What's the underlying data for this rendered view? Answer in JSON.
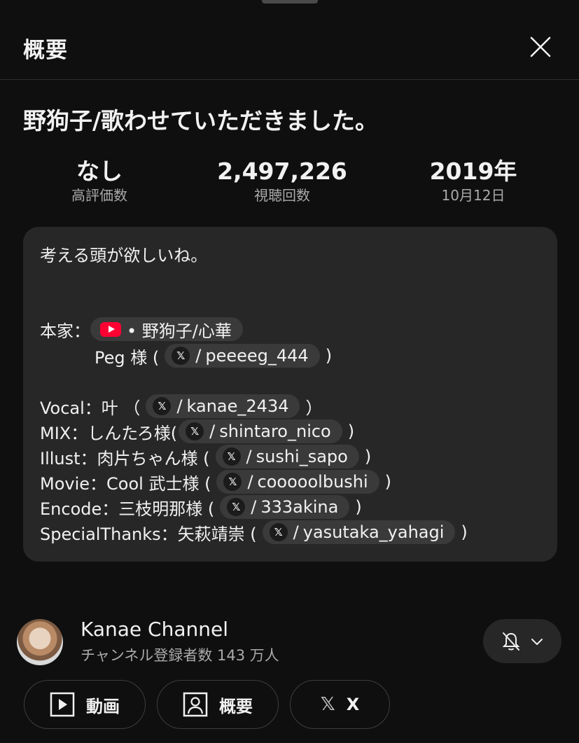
{
  "header": {
    "title": "概要"
  },
  "video": {
    "title": "野狗子/歌わせていただきました。"
  },
  "stats": [
    {
      "value": "なし",
      "label": "高評価数"
    },
    {
      "value": "2,497,226",
      "label": "視聴回数"
    },
    {
      "value": "2019年",
      "label": "10月12日"
    }
  ],
  "description": {
    "line1": "考える頭が欲しいね。",
    "honke_label": "本家：",
    "honke_chip": "• 野狗子/心華",
    "peg_before": "Peg 様 (",
    "peg_chip": "peeeeg_444",
    "peg_after": ")",
    "credits": [
      {
        "before": "Vocal：叶 （",
        "handle": "kanae_2434",
        "after": "）"
      },
      {
        "before": "MIX：しんたろ様(",
        "handle": "shintaro_nico",
        "after": ")"
      },
      {
        "before": "Illust：肉片ちゃん様 (",
        "handle": "sushi_sapo",
        "after": ")"
      },
      {
        "before": "Movie：Cool 武士様 (",
        "handle": "cooooolbushi",
        "after": ")"
      },
      {
        "before": "Encode：三枝明那様 (",
        "handle": "333akina",
        "after": ")"
      },
      {
        "before": "SpecialThanks：矢萩靖崇 (",
        "handle": "yasutaka_yahagi",
        "after": ")"
      }
    ],
    "x_glyph": "𝕏",
    "slash": "/"
  },
  "channel": {
    "name": "Kanae Channel",
    "subscribers": "チャンネル登録者数 143 万人"
  },
  "actions": {
    "videos": "動画",
    "about": "概要",
    "x": "X",
    "x_glyph": "𝕏"
  },
  "icons": {
    "close": "close-icon",
    "bell": "bell-off-icon",
    "chevron": "chevron-down-icon",
    "play": "play-box-icon",
    "person": "person-box-icon",
    "youtube": "youtube-icon",
    "x": "x-logo-icon"
  },
  "colors": {
    "background": "#0f0f0f",
    "card": "#272727",
    "chip": "#3a3a3a",
    "youtube_red": "#ff0033",
    "secondary_text": "#aaaaaa"
  }
}
